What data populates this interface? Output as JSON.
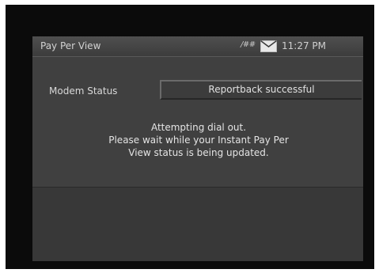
{
  "title_bar": {
    "title": "Pay Per View",
    "signal_icon": "signal-strength-icon",
    "signal_glyph": "/##",
    "mail_icon": "mail-icon",
    "time": "11:27 PM"
  },
  "modem": {
    "label": "Modem Status",
    "value": "Reportback successful"
  },
  "message": {
    "lines": [
      "Attempting dial out.",
      "Please wait while your Instant Pay Per",
      "View status is being updated."
    ]
  },
  "colors": {
    "screen_bg": "#3a3a3a",
    "frame_bg": "#0b0b0b",
    "text": "#e0e0e0"
  }
}
